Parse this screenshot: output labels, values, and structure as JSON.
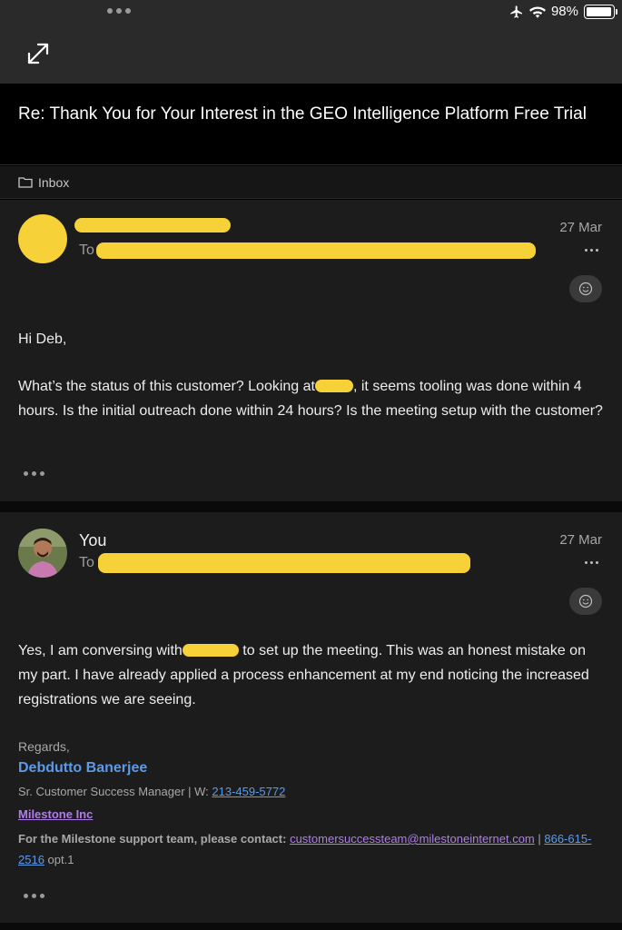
{
  "status": {
    "battery": "98%",
    "battery_level": 0.98,
    "icons": [
      "airplane-icon",
      "wifi-icon",
      "battery-icon"
    ]
  },
  "subject": "Re: Thank You for Your Interest in the GEO Intelligence Platform Free Trial",
  "folder": {
    "label": "Inbox",
    "icon": "folder-icon"
  },
  "messages": [
    {
      "to_label": "To",
      "date": "27 Mar",
      "greeting": "Hi Deb,",
      "para_a": "What’s the status of this customer? Looking at",
      "para_b": ", it seems tooling was done within 4 hours. Is the initial outreach done within 24 hours? Is the meeting setup with the customer?"
    },
    {
      "sender": "You",
      "to_label": "To",
      "date": "27 Mar",
      "para_a": "Yes, I am conversing with",
      "para_b": " to set up the meeting. This was an honest mistake on my part. I have already applied a process enhancement at my end noticing the increased registrations we are seeing.",
      "signature": {
        "regards": "Regards,",
        "name": "Debdutto Banerjee",
        "title_prefix": "Sr. Customer Success Manager | W: ",
        "phone": "213-459-5772",
        "company": "Milestone Inc",
        "support_prefix": "For the Milestone support team, please contact: ",
        "support_email": "customersuccessteam@milestoneinternet.com",
        "separator": " | ",
        "support_phone": "866-615-2516",
        "support_suffix": " opt.1"
      }
    }
  ],
  "colors": {
    "redaction": "#f6d238",
    "link": "#5b9bea",
    "company": "#b07ee8"
  }
}
